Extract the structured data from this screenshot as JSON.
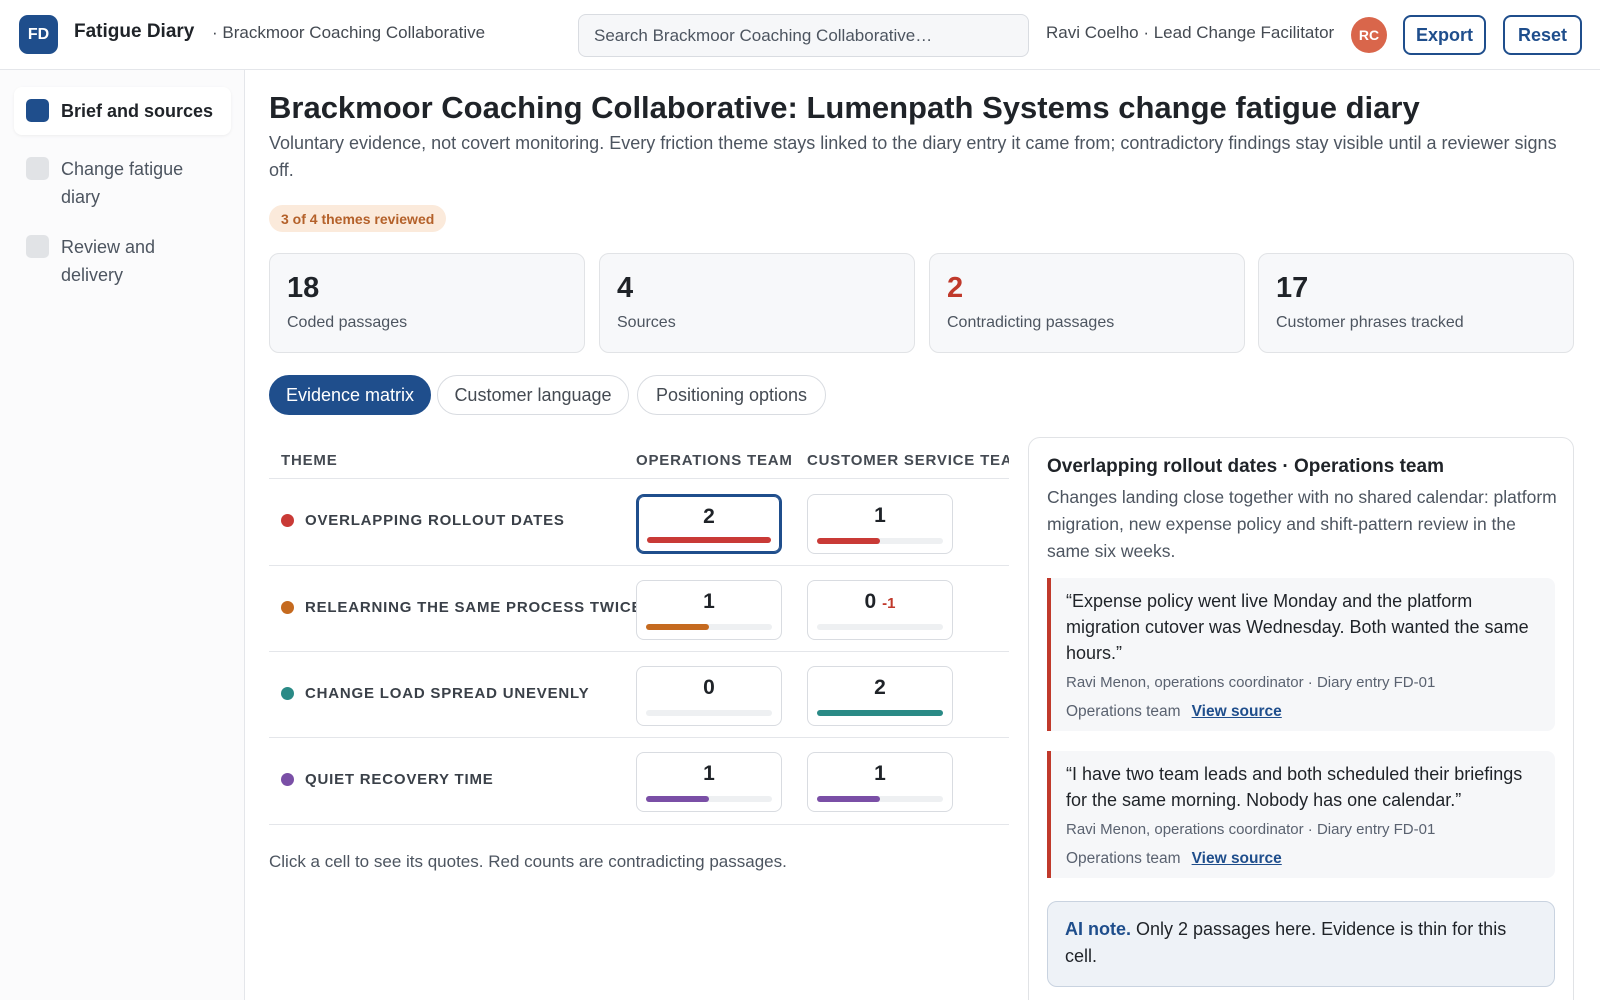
{
  "app": {
    "logo_initials": "FD",
    "title": "Fatigue Diary",
    "org_crumb": "· Brackmoor Coaching Collaborative"
  },
  "search": {
    "placeholder": "Search Brackmoor Coaching Collaborative…"
  },
  "user": {
    "name": "Ravi Coelho · Lead Change Facilitator",
    "initials": "RC"
  },
  "toolbar": {
    "export_label": "Export",
    "reset_label": "Reset"
  },
  "sidebar": {
    "items": [
      {
        "label": "Brief and sources",
        "active": true
      },
      {
        "label": "Change fatigue diary",
        "active": false
      },
      {
        "label": "Review and delivery",
        "active": false
      }
    ]
  },
  "page": {
    "title": "Brackmoor Coaching Collaborative: Lumenpath Systems change fatigue diary",
    "subtitle": "Voluntary evidence, not covert monitoring. Every friction theme stays linked to the diary entry it came from; contradictory findings stay visible until a reviewer signs off.",
    "review_badge": "3 of 4 themes reviewed"
  },
  "stats": [
    {
      "value": "18",
      "label": "Coded passages"
    },
    {
      "value": "4",
      "label": "Sources"
    },
    {
      "value": "2",
      "label": "Contradicting passages",
      "alert": true
    },
    {
      "value": "17",
      "label": "Customer phrases tracked"
    }
  ],
  "tabs": [
    {
      "label": "Evidence matrix",
      "active": true
    },
    {
      "label": "Customer language",
      "active": false
    },
    {
      "label": "Positioning options",
      "active": false
    }
  ],
  "matrix": {
    "headers": {
      "theme": "THEME",
      "col1": "OPERATIONS TEAM",
      "col2": "CUSTOMER SERVICE TEAM"
    },
    "rows": [
      {
        "theme": "OVERLAPPING ROLLOUT DATES",
        "color": "#c93a36",
        "cells": [
          {
            "count": "2",
            "level": 1.0,
            "selected": true
          },
          {
            "count": "1",
            "level": 0.5
          }
        ]
      },
      {
        "theme": "RELEARNING THE SAME PROCESS TWICE",
        "color": "#c56a1f",
        "cells": [
          {
            "count": "1",
            "level": 0.5
          },
          {
            "count": "0",
            "delta": "-1",
            "level": 0
          }
        ]
      },
      {
        "theme": "CHANGE LOAD SPREAD UNEVENLY",
        "color": "#2a8a86",
        "cells": [
          {
            "count": "0",
            "level": 0
          },
          {
            "count": "2",
            "level": 1.0
          }
        ]
      },
      {
        "theme": "QUIET RECOVERY TIME",
        "color": "#7a4fa6",
        "cells": [
          {
            "count": "1",
            "level": 0.5
          },
          {
            "count": "1",
            "level": 0.5
          }
        ]
      }
    ],
    "note": "Click a cell to see its quotes. Red counts are contradicting passages."
  },
  "detail": {
    "title": "Overlapping rollout dates · Operations team",
    "description": "Changes landing close together with no shared calendar: platform migration, new expense policy and shift-pattern review in the same six weeks.",
    "quotes": [
      {
        "text": "“Expense policy went live Monday and the platform migration cutover was Wednesday. Both wanted the same hours.”",
        "meta": "Ravi Menon, operations coordinator · Diary entry FD-01",
        "team": "Operations team",
        "link": "View source"
      },
      {
        "text": "“I have two team leads and both scheduled their briefings for the same morning. Nobody has one calendar.”",
        "meta": "Ravi Menon, operations coordinator · Diary entry FD-01",
        "team": "Operations team",
        "link": "View source"
      }
    ],
    "ai_note_label": "AI note.",
    "ai_note_text": " Only 2 passages here. Evidence is thin for this cell."
  }
}
